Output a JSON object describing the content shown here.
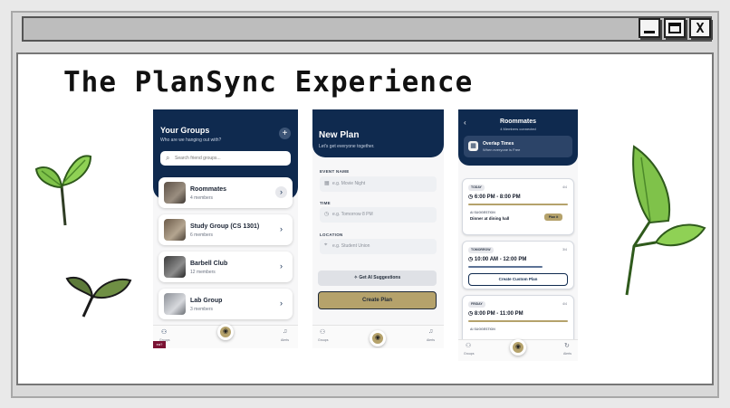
{
  "window": {
    "title": "The PlanSync Experience",
    "minimize": "_",
    "close": "X"
  },
  "groups_screen": {
    "title": "Your Groups",
    "subtitle": "Who are we hanging out with?",
    "add": "+",
    "search_placeholder": "Search friend groups...",
    "groups": [
      {
        "name": "Roommates",
        "members": "4 members"
      },
      {
        "name": "Study Group (CS 1301)",
        "members": "6 members"
      },
      {
        "name": "Barbell Club",
        "members": "12 members"
      },
      {
        "name": "Lab Group",
        "members": "3 members"
      }
    ],
    "tab_groups": "Groups",
    "tab_alerts": "Alerts",
    "badge": "ea?"
  },
  "new_plan_screen": {
    "title": "New Plan",
    "subtitle": "Let's get everyone together.",
    "event_label": "EVENT NAME",
    "event_placeholder": "e.g. Movie Night",
    "time_label": "TIME",
    "time_placeholder": "e.g. Tomorrow 8 PM",
    "location_label": "LOCATION",
    "location_placeholder": "e.g. Student Union",
    "ai_button": "Get AI Suggestions",
    "create_button": "Create Plan",
    "tab_groups": "Groups",
    "tab_alerts": "Alerts"
  },
  "roommates_screen": {
    "back": "‹",
    "title": "Roommates",
    "subtitle": "4 Members connected",
    "overlap_title": "Overlap Times",
    "overlap_sub": "When everyone is Free",
    "slots": [
      {
        "day": "TODAY",
        "count": "4/4",
        "time": "6:00 PM - 8:00 PM",
        "suggestion_label": "AI SUGGESTION",
        "suggestion": "Dinner at dining hall",
        "action": "Plan it"
      },
      {
        "day": "TOMORROW",
        "count": "3/4",
        "time": "10:00 AM - 12:00 PM",
        "action": "Create Custom Plan"
      },
      {
        "day": "FRIDAY",
        "count": "4/4",
        "time": "8:00 PM - 11:00 PM",
        "suggestion_label": "AI SUGGESTION"
      }
    ],
    "tab_groups": "Groups",
    "tab_alerts": "Alerts"
  },
  "colors": {
    "navy": "#0f2a4f",
    "gold": "#b5a26b",
    "leaf": "#7fc24a"
  },
  "icons": [
    "search-icon",
    "plus-icon",
    "chevron-right-icon",
    "users-icon",
    "bell-icon",
    "calendar-icon",
    "clock-icon",
    "pin-icon",
    "sparkle-icon",
    "back-icon",
    "leaf-icon"
  ]
}
